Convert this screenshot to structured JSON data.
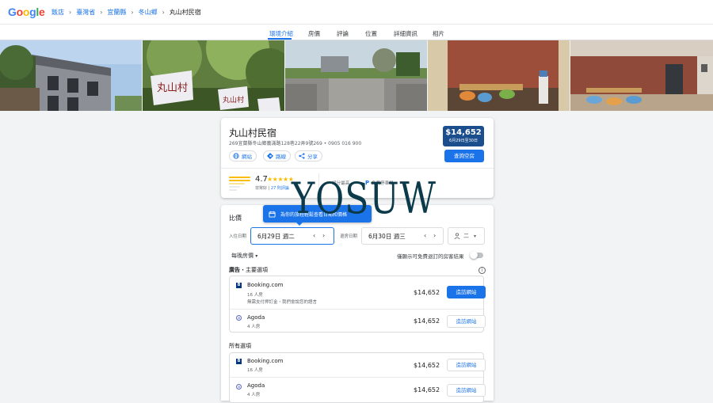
{
  "topbar": {
    "logo": "Google",
    "breadcrumbs": [
      "飯店",
      "臺灣省",
      "宜蘭縣",
      "冬山鄉",
      "丸山村民宿"
    ]
  },
  "tabs": [
    "環境介紹",
    "房價",
    "評論",
    "位置",
    "詳細資訊",
    "相片"
  ],
  "hotel": {
    "name": "丸山村民宿",
    "address": "269宜蘭縣冬山鄉義滿路128巷22弄9號269 • 0905 016 900",
    "actions": {
      "website": "網站",
      "directions": "路線",
      "share": "分享"
    },
    "price_badge": {
      "amount": "$14,652",
      "dates": "6月29日至30日"
    },
    "check_button": "查詢空房",
    "rating": "4.7",
    "stars": "★★★★★",
    "rating_text": "非常好",
    "reviews_link": "27 則評論",
    "amenities": [
      "評分最高",
      "免費停車場"
    ]
  },
  "prices": {
    "title": "比價",
    "tooltip": "為你的旅程輕鬆查看日期和價格",
    "checkin_label": "入住日期",
    "checkin_value": "6月29日 週二",
    "checkout_label": "退房日期",
    "checkout_value": "6月30日 週三",
    "guests": "二",
    "nightly_label": "每晚房價",
    "toggle_label": "僅顯示可免費退訂的房客結果",
    "ads_title_bold": "廣告",
    "ads_title_rest": "・主要選項",
    "all_title": "所有選項",
    "visit_label": "造訪網站",
    "featured": [
      {
        "name": "Booking.com",
        "sub": "16 人房",
        "sub2": "無需支付押訂金・我們會說您的語言",
        "price": "$14,652"
      },
      {
        "name": "Agoda",
        "sub": "4 人房",
        "sub2": "",
        "price": "$14,652"
      }
    ],
    "all": [
      {
        "name": "Booking.com",
        "sub": "16 人房",
        "price": "$14,652"
      },
      {
        "name": "Agoda",
        "sub": "4 人房",
        "price": "$14,652"
      }
    ]
  },
  "watermark": "YOSUW",
  "colors": {
    "accent": "#1a73e8",
    "badge": "#1a4e8c",
    "star": "#fbbc04"
  }
}
